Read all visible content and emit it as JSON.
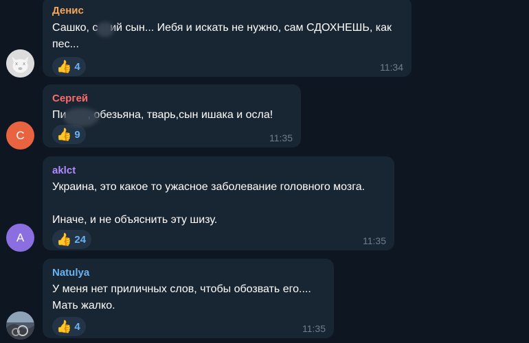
{
  "colors": {
    "background": "#0e1621",
    "bubble": "#182533",
    "timestamp": "#6d7f8f",
    "reaction_count": "#6ab3f3"
  },
  "messages": [
    {
      "sender": "Денис",
      "sender_color": "#f5a65b",
      "avatar_letter": "",
      "avatar_color": "#e8e8e8",
      "avatar_icon": "dog-face-avatar-icon",
      "text": "Сашко, с    ий сын... Иебя и искать не нужно, сам СДОХНЕШЬ, как пес...",
      "reaction_icon": "thumbs-up-icon",
      "reaction_count": "4",
      "time": "11:34"
    },
    {
      "sender": "Сергей",
      "sender_color": "#ff6b6b",
      "avatar_letter": "С",
      "avatar_color": "#e8633f",
      "text": "Пи       , обезьяна, тварь,сын ишака и осла!",
      "reaction_icon": "thumbs-up-icon",
      "reaction_count": "9",
      "time": "11:35"
    },
    {
      "sender": "aklct",
      "sender_color": "#b18cfe",
      "avatar_letter": "A",
      "avatar_color": "#8b6fe0",
      "text": "Украина, это какое то ужасное заболевание головного мозга.\n\nИначе, и не объяснить эту шизу.",
      "reaction_icon": "thumbs-up-icon",
      "reaction_count": "24",
      "time": "11:35"
    },
    {
      "sender": "Natulya",
      "sender_color": "#6ab3f3",
      "avatar_letter": "",
      "avatar_color": "#5a6b80",
      "avatar_icon": "photo-avatar-icon",
      "text": "У меня нет приличных слов, чтобы обозвать его....\nМать жалко.",
      "reaction_icon": "thumbs-up-icon",
      "reaction_count": "4",
      "time": "11:35"
    }
  ]
}
